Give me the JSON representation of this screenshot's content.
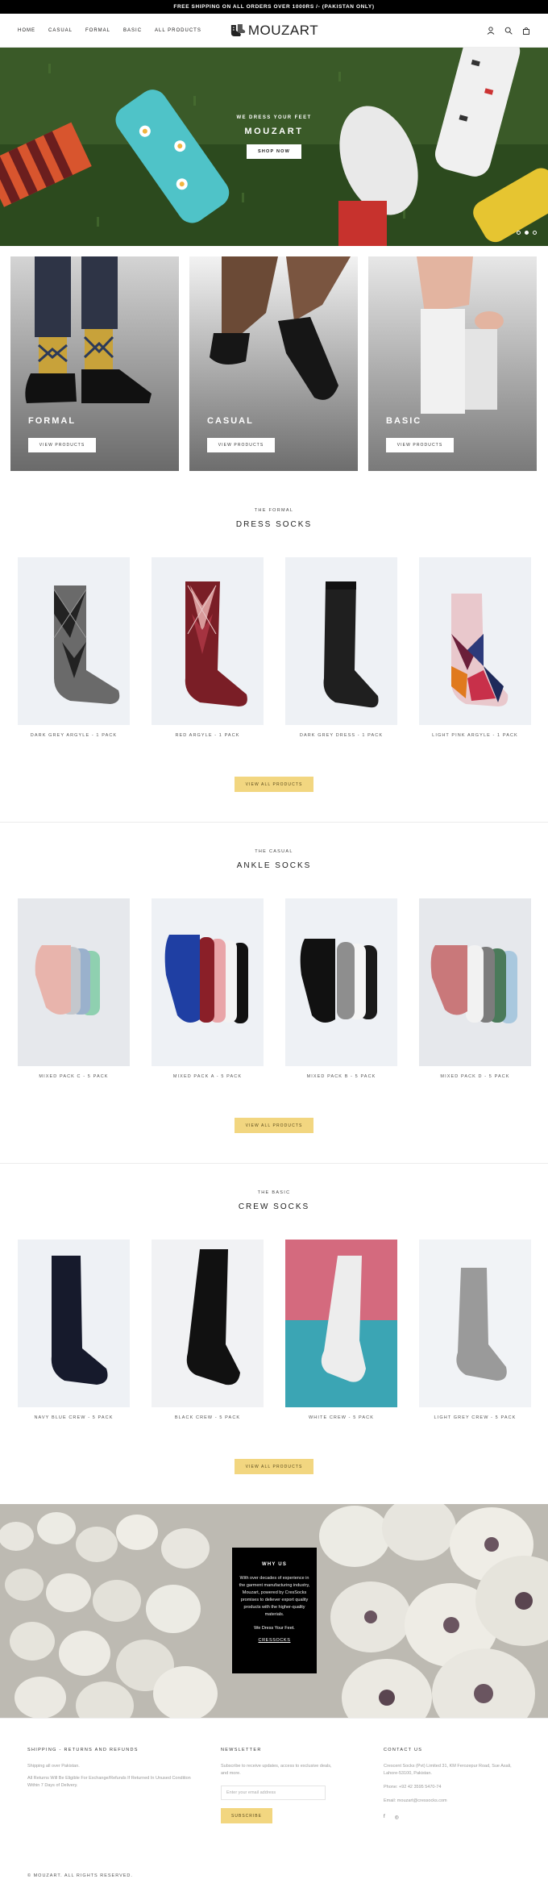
{
  "announcement": "FREE SHIPPING ON ALL ORDERS OVER 1000RS /- (PAKISTAN ONLY)",
  "header": {
    "nav": [
      "HOME",
      "CASUAL",
      "FORMAL",
      "BASIC",
      "ALL PRODUCTS"
    ],
    "logo": "MOUZART",
    "icons": [
      "account-icon",
      "search-icon",
      "cart-icon"
    ]
  },
  "hero": {
    "kicker": "WE DRESS YOUR FEET",
    "title": "MOUZART",
    "button": "SHOP NOW",
    "slides": 3,
    "active_slide": 2
  },
  "categories": [
    {
      "title": "FORMAL",
      "button": "VIEW PRODUCTS"
    },
    {
      "title": "CASUAL",
      "button": "VIEW PRODUCTS"
    },
    {
      "title": "BASIC",
      "button": "VIEW PRODUCTS"
    }
  ],
  "sections": [
    {
      "kicker": "THE FORMAL",
      "title": "DRESS SOCKS",
      "products": [
        "DARK GREY ARGYLE - 1 PACK",
        "RED ARGYLE - 1 PACK",
        "DARK GREY DRESS - 1 PACK",
        "LIGHT PINK ARGYLE - 1 PACK"
      ],
      "view_all": "VIEW ALL PRODUCTS"
    },
    {
      "kicker": "THE CASUAL",
      "title": "ANKLE SOCKS",
      "products": [
        "MIXED PACK C - 5 PACK",
        "MIXED PACK A - 5 PACK",
        "MIXED PACK B - 5 PACK",
        "MIXED PACK D - 5 PACK"
      ],
      "view_all": "VIEW ALL PRODUCTS"
    },
    {
      "kicker": "THE BASIC",
      "title": "CREW SOCKS",
      "products": [
        "NAVY BLUE CREW - 5 PACK",
        "BLACK CREW - 5 PACK",
        "WHITE CREW - 5 PACK",
        "LIGHT GREY CREW - 5 PACK"
      ],
      "view_all": "VIEW ALL PRODUCTS"
    }
  ],
  "why_us": {
    "title": "WHY US",
    "text": "With over decades of experience in the garment manufacturing industry, Mouzart, powered by CresSocks promises to deliever export quality products with the higher-quality materials.",
    "tagline": "We Dress Your Feet.",
    "link": "CRESSOCKS"
  },
  "footer": {
    "shipping": {
      "heading": "SHIPPING - RETURNS AND REFUNDS",
      "line1": "Shipping all over Pakistan.",
      "line2": "All Returns Will Be Eligible For Exchange/Refunds If Returned In Unused Condition Within 7 Days of Delivery."
    },
    "newsletter": {
      "heading": "NEWSLETTER",
      "text": "Subscribe to receive updates, access to exclusive deals, and more.",
      "placeholder": "Enter your email address",
      "button": "SUBSCRIBE"
    },
    "contact": {
      "heading": "CONTACT US",
      "address": "Crescent Socks (Pvt) Limited 31, KM Ferozepur Road, Sue Asali, Lahore-53100, Pakistan.",
      "phone": "Phone: +92 42 3595 5470-74",
      "email": "Email: mouzart@cressocks.com",
      "social": [
        "f",
        "◎"
      ]
    },
    "copyright": "© MOUZART. ALL RIGHTS RESERVED."
  },
  "colors": {
    "accent_button": "#f2d680",
    "announcement_bg": "#000000"
  }
}
